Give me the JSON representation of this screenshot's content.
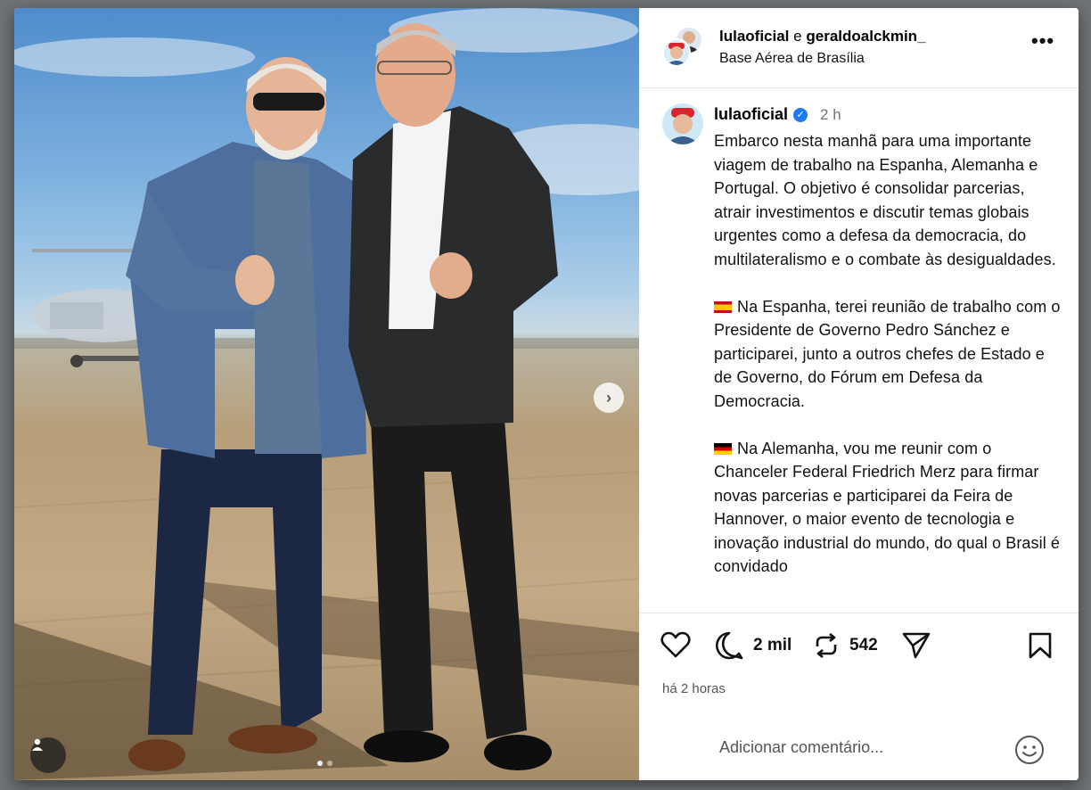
{
  "post": {
    "authors": [
      "lulaoficial",
      "geraldoalckmin_"
    ],
    "author_join": "e",
    "location": "Base Aérea de Brasília",
    "more_label": "•••"
  },
  "caption": {
    "username": "lulaoficial",
    "verified_mark": "✓",
    "time": "2 h",
    "paragraphs": [
      "Embarco nesta manhã para uma importante viagem de trabalho na Espanha, Alemanha e Portugal. O objetivo é consolidar parcerias, atrair investimentos e discutir temas globais urgentes como a defesa da democracia, do multilateralismo e o combate às desigualdades.",
      "Na Espanha, terei reunião de trabalho com o Presidente de Governo Pedro Sánchez e participarei, junto a outros chefes de Estado e de Governo, do Fórum em Defesa da Democracia.",
      "Na Alemanha, vou me reunir com o Chanceler Federal Friedrich Merz para firmar novas parcerias e participarei da Feira de Hannover, o maior evento de tecnologia e inovação industrial do mundo, do qual o Brasil é convidado"
    ],
    "flags": [
      "flag-spain-icon",
      "flag-germany-icon"
    ]
  },
  "actions": {
    "comments_count": "2 mil",
    "reposts_count": "542",
    "time_ago": "há 2 horas"
  },
  "comment_box": {
    "placeholder": "Adicionar comentário..."
  },
  "carousel": {
    "next_label": "›",
    "total": 2,
    "current": 1
  },
  "colors": {
    "verified": "#1d7bf2",
    "text_secondary": "#737373"
  }
}
